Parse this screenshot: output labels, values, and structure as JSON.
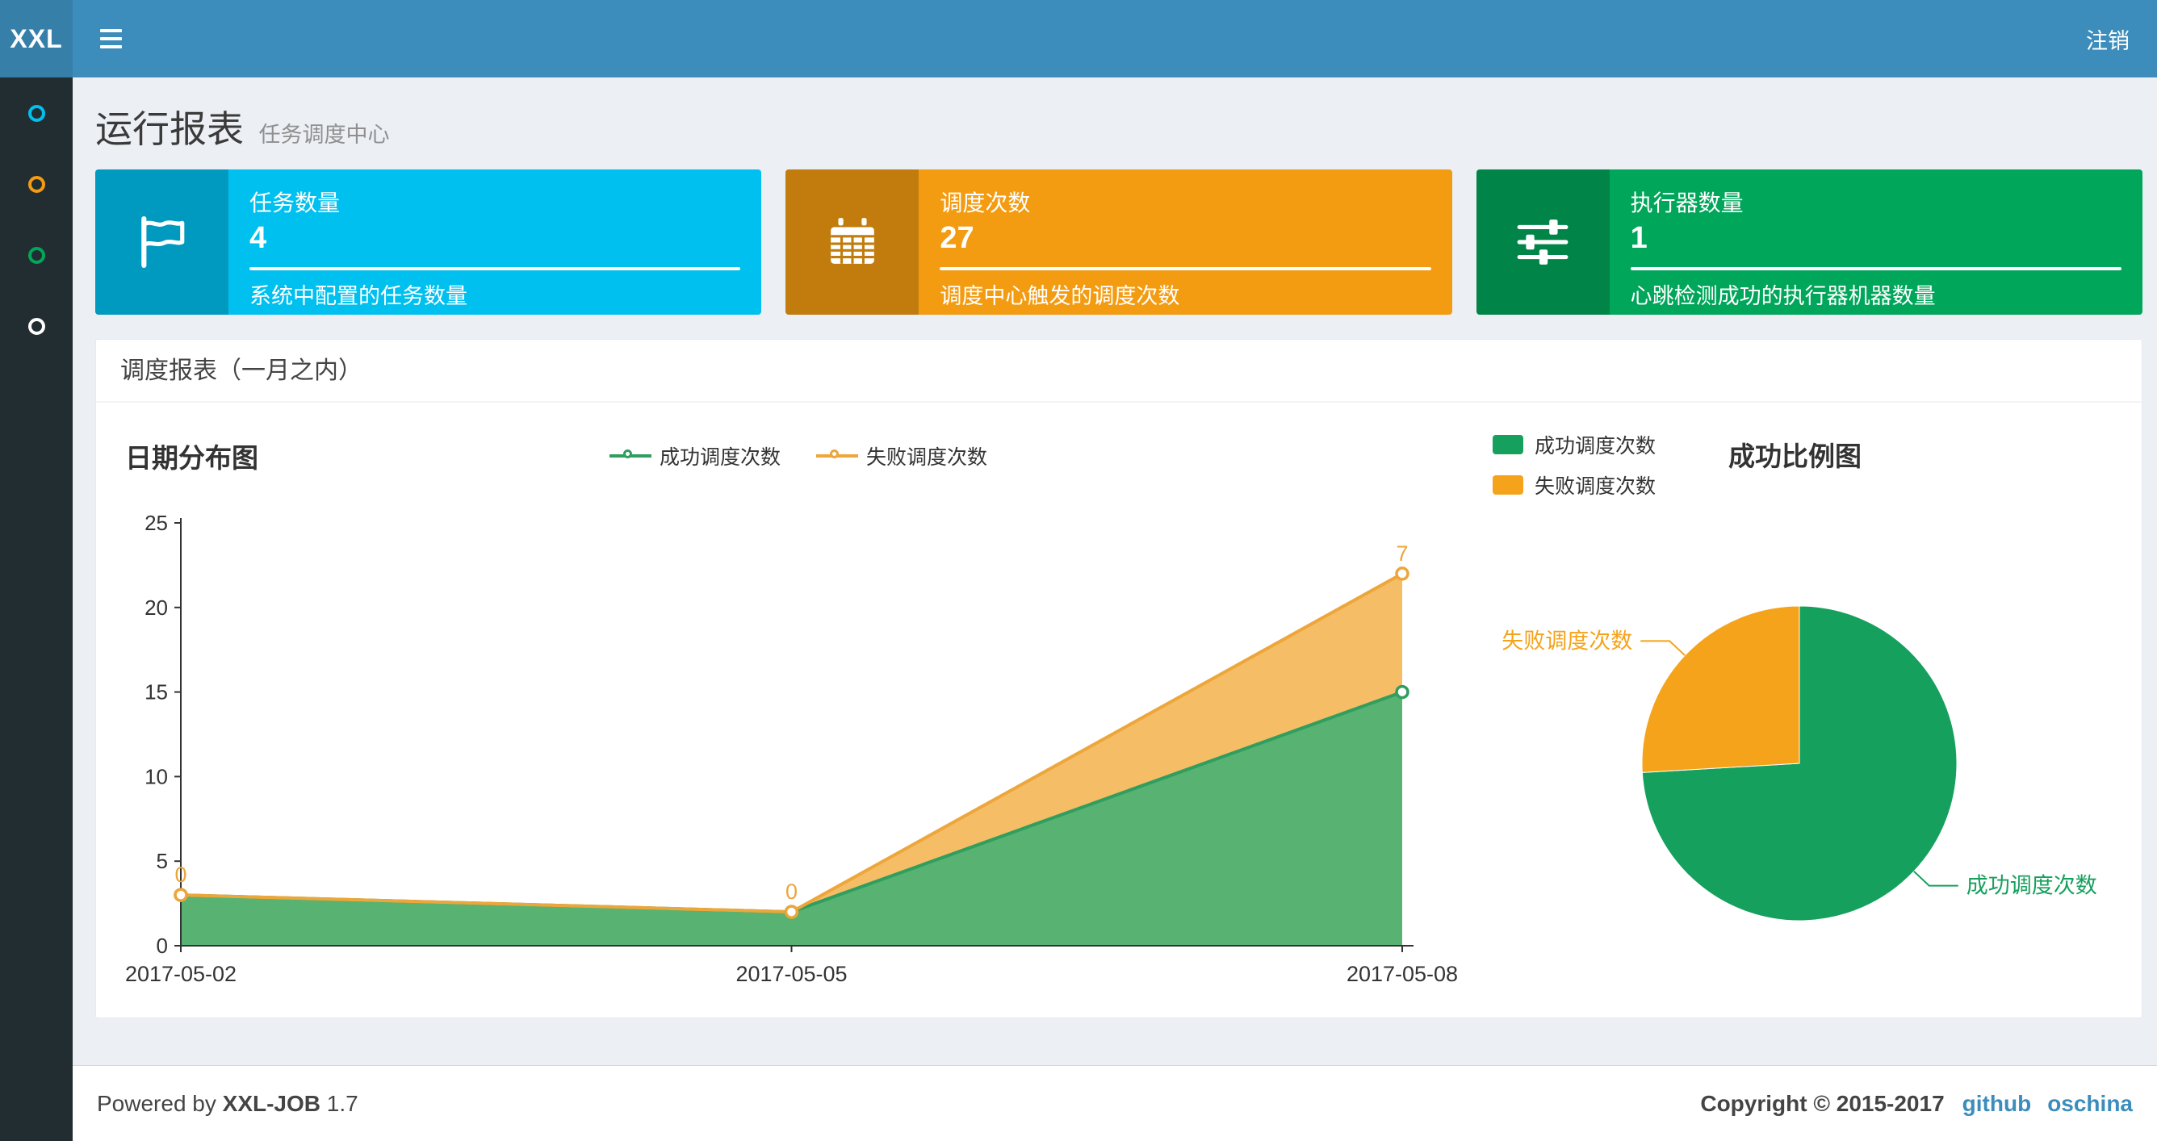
{
  "navbar": {
    "logo": "XXL",
    "logout": "注销"
  },
  "sidebar": {
    "items": [
      {
        "color": "#00c0ef"
      },
      {
        "color": "#f39c12"
      },
      {
        "color": "#00a65a"
      },
      {
        "color": "#ffffff"
      }
    ]
  },
  "page_header": {
    "title": "运行报表",
    "subtitle": "任务调度中心"
  },
  "info_boxes": [
    {
      "title": "任务数量",
      "number": "4",
      "description": "系统中配置的任务数量",
      "color": "#00c0ef",
      "icon": "flag-icon"
    },
    {
      "title": "调度次数",
      "number": "27",
      "description": "调度中心触发的调度次数",
      "color": "#f39c12",
      "icon": "calendar-icon"
    },
    {
      "title": "执行器数量",
      "number": "1",
      "description": "心跳检测成功的执行器机器数量",
      "color": "#00a65a",
      "icon": "sliders-icon"
    }
  ],
  "panel": {
    "title": "调度报表（一月之内）"
  },
  "chart_data": [
    {
      "type": "area",
      "title": "日期分布图",
      "stacked": true,
      "x": [
        "2017-05-02",
        "2017-05-05",
        "2017-05-08"
      ],
      "series": [
        {
          "name": "成功调度次数",
          "values": [
            3,
            2,
            15
          ],
          "color": "#2f9e5f",
          "area_color": "#58b271"
        },
        {
          "name": "失败调度次数",
          "values": [
            0,
            0,
            7
          ],
          "color": "#eda63a",
          "area_color": "#f5bd66",
          "point_labels": [
            "0",
            "0",
            "7"
          ]
        }
      ],
      "ylim": [
        0,
        25
      ],
      "yticks": [
        0,
        5,
        10,
        15,
        20,
        25
      ],
      "legend_position": "top",
      "grid": false
    },
    {
      "type": "pie",
      "title": "成功比例图",
      "slices": [
        {
          "name": "成功调度次数",
          "value": 20,
          "color": "#16a05d"
        },
        {
          "name": "失败调度次数",
          "value": 7,
          "color": "#f5a31a"
        }
      ],
      "legend_position": "top-left"
    }
  ],
  "footer": {
    "powered_by": "Powered by",
    "product": "XXL-JOB",
    "version": "1.7",
    "copyright": "Copyright © 2015-2017",
    "link_github": "github",
    "link_oschina": "oschina"
  }
}
